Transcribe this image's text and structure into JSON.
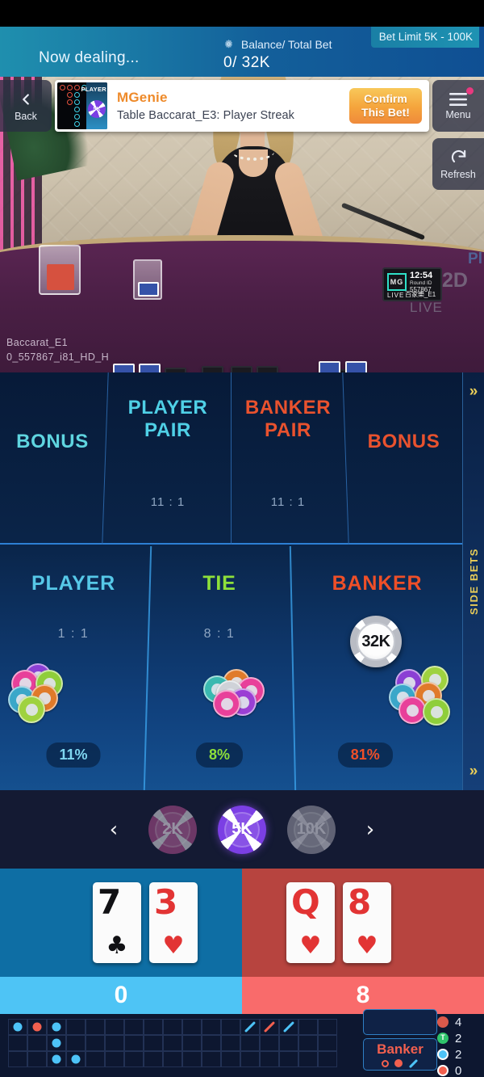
{
  "topbar": {
    "status_text": "Now dealing...",
    "balance_label": "Balance/ Total Bet",
    "balance_value": "0/ 32K",
    "bet_limit": "Bet Limit 5K - 100K",
    "gear_icon": "gear-icon"
  },
  "controls": {
    "back_label": "Back",
    "back_icon": "chevron-left-icon",
    "menu_label": "Menu",
    "menu_icon": "hamburger-icon",
    "refresh_label": "Refresh",
    "refresh_icon": "refresh-icon"
  },
  "banner": {
    "title": "MGenie",
    "subtitle": "Table Baccarat_E3: Player Streak",
    "cta_line1": "Confirm",
    "cta_line2": "This Bet!",
    "thumb_tag": "PLAYER",
    "thumb_chip": "5K"
  },
  "video": {
    "stream_table": "Baccarat_E1",
    "stream_id": "0_557867_i81_HD_H",
    "monitor": {
      "logo": "MG",
      "live": "LIVE",
      "time": "12:54",
      "round_label": "Round ID",
      "round_id": "557867",
      "table_cn": "百家樂_E1"
    },
    "watermark_live": "LIVE",
    "watermark_num": "2D"
  },
  "side_bets": {
    "cells": [
      {
        "label": "BONUS",
        "odds": "",
        "color": "#5fd5e0"
      },
      {
        "label": "PLAYER\nPAIR",
        "label_l1": "PLAYER",
        "label_l2": "PAIR",
        "odds": "11 : 1",
        "color": "#4fd0e6"
      },
      {
        "label": "BANKER\nPAIR",
        "label_l1": "BANKER",
        "label_l2": "PAIR",
        "odds": "11 : 1",
        "color": "#e9522e"
      },
      {
        "label": "BONUS",
        "odds": "",
        "color": "#e9522e"
      }
    ]
  },
  "main_bets": {
    "player": {
      "label": "PLAYER",
      "odds": "1 : 1",
      "percent": "11%",
      "color": "#56c8e8"
    },
    "tie": {
      "label": "TIE",
      "odds": "8 : 1",
      "percent": "8%",
      "color": "#8ee03a"
    },
    "banker": {
      "label": "BANKER",
      "odds": "",
      "percent": "81%",
      "color": "#ef4f28",
      "bet_chip": "32K"
    }
  },
  "rail": {
    "label": "SIDE BETS",
    "chevron_top": "»",
    "chevron_bottom": "»",
    "ghost_text": "Pl"
  },
  "chip_selector": {
    "prev_icon": "chevron-left-icon",
    "next_icon": "chevron-right-icon",
    "chips": [
      {
        "value": "2K",
        "selected": false
      },
      {
        "value": "5K",
        "selected": true
      },
      {
        "value": "10K",
        "selected": false
      }
    ]
  },
  "results": {
    "player": {
      "total": "0",
      "cards": [
        {
          "rank": "7",
          "suit": "♣",
          "color": "black"
        },
        {
          "rank": "3",
          "suit": "♥",
          "color": "red"
        }
      ]
    },
    "banker": {
      "total": "8",
      "cards": [
        {
          "rank": "Q",
          "suit": "♥",
          "color": "red"
        },
        {
          "rank": "8",
          "suit": "♥",
          "color": "red"
        }
      ]
    }
  },
  "roadmap": {
    "big_road": [
      {
        "col": 0,
        "row": 0,
        "type": "p"
      },
      {
        "col": 1,
        "row": 0,
        "type": "b"
      },
      {
        "col": 2,
        "row": 0,
        "type": "p"
      },
      {
        "col": 2,
        "row": 1,
        "type": "p"
      },
      {
        "col": 2,
        "row": 2,
        "type": "p"
      },
      {
        "col": 3,
        "row": 2,
        "type": "p"
      },
      {
        "col": 12,
        "row": 0,
        "type": "slash-p"
      },
      {
        "col": 13,
        "row": 0,
        "type": "slash-b"
      },
      {
        "col": 14,
        "row": 0,
        "type": "slash-p"
      }
    ],
    "prediction": {
      "label": "Banker",
      "icons": [
        "circle-outline-icon",
        "dot-icon",
        "slash-icon"
      ]
    },
    "stats": [
      {
        "icon": "banker-icon",
        "value": "4"
      },
      {
        "icon": "tie-icon",
        "value": "2"
      },
      {
        "icon": "player-pair-icon",
        "value": "2"
      },
      {
        "icon": "banker-pair-icon",
        "value": "0"
      }
    ]
  }
}
